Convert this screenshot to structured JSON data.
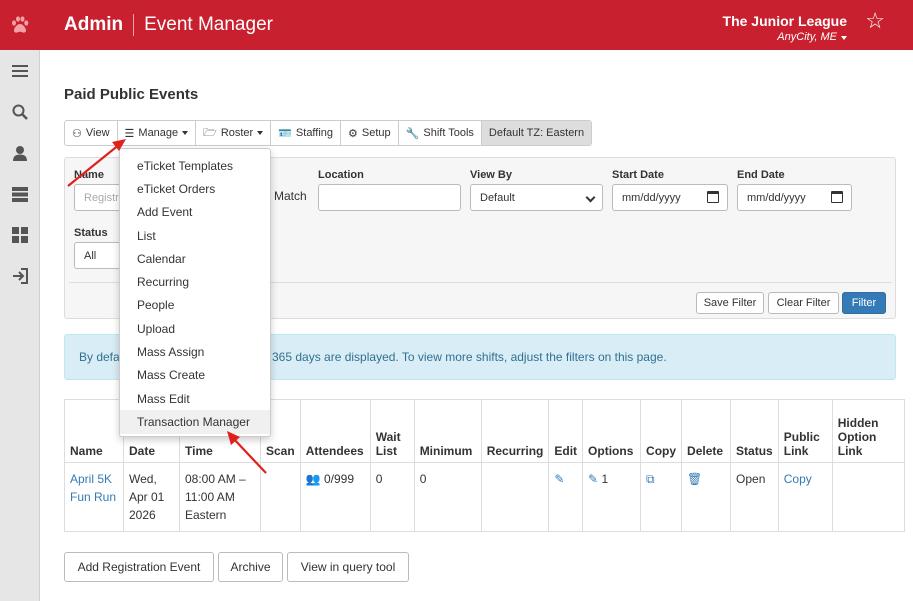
{
  "header": {
    "admin": "Admin",
    "section": "Event Manager",
    "org_name": "The Junior League",
    "org_city": "AnyCity, ME"
  },
  "page": {
    "title": "Paid Public Events"
  },
  "toolbar": {
    "view": "View",
    "manage": "Manage",
    "roster": "Roster",
    "staffing": "Staffing",
    "setup": "Setup",
    "shift_tools": "Shift Tools",
    "timezone": "Default TZ: Eastern"
  },
  "manage_menu": [
    "eTicket Templates",
    "eTicket Orders",
    "Add Event",
    "List",
    "Calendar",
    "Recurring",
    "People",
    "Upload",
    "Mass Assign",
    "Mass Create",
    "Mass Edit",
    "Transaction Manager"
  ],
  "filter": {
    "name_label": "Name",
    "name_placeholder": "Registra",
    "match_text": "Match",
    "location_label": "Location",
    "viewby_label": "View By",
    "viewby_value": "Default",
    "start_label": "Start Date",
    "start_placeholder": "mm/dd/yyyy",
    "end_label": "End Date",
    "end_placeholder": "mm/dd/yyyy",
    "status_label": "Status",
    "status_value": "All",
    "save_filter": "Save Filter",
    "clear_filter": "Clear Filter",
    "filter": "Filter"
  },
  "info": {
    "left": "By defa",
    "right": "365 days are displayed. To view more shifts, adjust the filters on this page."
  },
  "table": {
    "headers": [
      "Name",
      "Date",
      "Time",
      "Scan",
      "Attendees",
      "Wait List",
      "Minimum",
      "Recurring",
      "Edit",
      "Options",
      "Copy",
      "Delete",
      "Status",
      "Public Link",
      "Hidden Option Link"
    ],
    "row": {
      "name": "April 5K Fun Run",
      "date": "Wed, Apr 01 2026",
      "time": "08:00 AM – 11:00 AM Eastern",
      "scan": "",
      "attendees": "0/999",
      "wait_list": "0",
      "minimum": "0",
      "recurring": "",
      "options": "1",
      "status": "Open",
      "public_link": "Copy"
    }
  },
  "actions": {
    "add_registration": "Add Registration Event",
    "archive": "Archive",
    "query_tool": "View in query tool"
  },
  "colors": {
    "brand": "#c8202f",
    "link": "#337ab7",
    "primary": "#337ab7",
    "info_bg": "#d9edf7",
    "arrow": "#e0201b"
  }
}
